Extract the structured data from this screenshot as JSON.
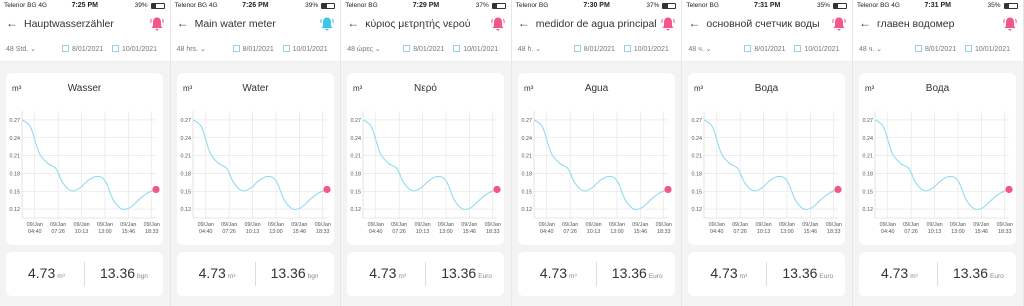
{
  "accent": "#f2568a",
  "line_color": "#8fdcf2",
  "screens": [
    {
      "carrier": "Telenor BG  4G",
      "time": "7:25 PM",
      "battery_pct": "39%",
      "battery": 0.39,
      "title": "Hauptwasserzähler",
      "period": "48 Std.",
      "date_from": "8/01/2021",
      "date_to": "10/01/2021",
      "chart_unit": "m³",
      "chart_title": "Wasser",
      "volume": "4.73",
      "volume_unit": "m³",
      "cost": "13.36",
      "currency": "bgn",
      "bell_color": "#f2568a"
    },
    {
      "carrier": "Telenor BG  4G",
      "time": "7:26 PM",
      "battery_pct": "39%",
      "battery": 0.39,
      "title": "Main water meter",
      "period": "48 hrs.",
      "date_from": "8/01/2021",
      "date_to": "10/01/2021",
      "chart_unit": "m³",
      "chart_title": "Water",
      "volume": "4.73",
      "volume_unit": "m³",
      "cost": "13.36",
      "currency": "bgn",
      "bell_color": "#3ec6e8"
    },
    {
      "carrier": "Telenor BG",
      "time": "7:29 PM",
      "battery_pct": "37%",
      "battery": 0.37,
      "title": "κύριος μετρητής νερού",
      "period": "48 ώρες",
      "date_from": "8/01/2021",
      "date_to": "10/01/2021",
      "chart_unit": "m³",
      "chart_title": "Νερό",
      "volume": "4.73",
      "volume_unit": "m³",
      "cost": "13.36",
      "currency": "Euro",
      "bell_color": "#f2568a"
    },
    {
      "carrier": "Telenor BG",
      "time": "7:30 PM",
      "battery_pct": "37%",
      "battery": 0.37,
      "title": "medidor de agua principal",
      "period": "48 h.",
      "date_from": "8/01/2021",
      "date_to": "10/01/2021",
      "chart_unit": "m³",
      "chart_title": "Agua",
      "volume": "4.73",
      "volume_unit": "m³",
      "cost": "13.36",
      "currency": "Euro",
      "bell_color": "#f2568a"
    },
    {
      "carrier": "Telenor BG",
      "time": "7:31 PM",
      "battery_pct": "35%",
      "battery": 0.35,
      "title": "основной счетчик воды",
      "period": "48 ч.",
      "date_from": "8/01/2021",
      "date_to": "10/01/2021",
      "chart_unit": "m³",
      "chart_title": "Вода",
      "volume": "4.73",
      "volume_unit": "m³",
      "cost": "13.36",
      "currency": "Euro",
      "bell_color": "#f2568a"
    },
    {
      "carrier": "Telenor BG  4G",
      "time": "7:31 PM",
      "battery_pct": "35%",
      "battery": 0.35,
      "title": "главен водомер",
      "period": "48 ч.",
      "date_from": "8/01/2021",
      "date_to": "10/01/2021",
      "chart_unit": "m³",
      "chart_title": "Вода",
      "volume": "4.73",
      "volume_unit": "m³",
      "cost": "13.36",
      "currency": "Euro",
      "bell_color": "#f2568a"
    }
  ],
  "chart_data": {
    "type": "line",
    "y_ticks": [
      "0.27",
      "0.24",
      "0.21",
      "0.18",
      "0.15",
      "0.12"
    ],
    "y_tick_values": [
      0.27,
      0.24,
      0.21,
      0.18,
      0.15,
      0.12
    ],
    "ylim": [
      0.105,
      0.285
    ],
    "x_ticks": [
      {
        "day": "09/Jan",
        "time": "04:40"
      },
      {
        "day": "09/Jan",
        "time": "07:26"
      },
      {
        "day": "09/Jan",
        "time": "10:13"
      },
      {
        "day": "09/Jan",
        "time": "13:00"
      },
      {
        "day": "09/Jan",
        "time": "15:46"
      },
      {
        "day": "09/Jan",
        "time": "18:33"
      }
    ],
    "grid": true,
    "series": [
      {
        "x": [
          0,
          0.4,
          0.8,
          1.2,
          1.6,
          1.9,
          2.3,
          2.7,
          3.1,
          3.5,
          3.9,
          4.3,
          4.7,
          5.1,
          5.5,
          5.9,
          6.3
        ],
        "values": [
          0.27,
          0.258,
          0.215,
          0.197,
          0.188,
          0.165,
          0.151,
          0.155,
          0.168,
          0.175,
          0.168,
          0.135,
          0.12,
          0.123,
          0.136,
          0.147,
          0.153
        ]
      }
    ],
    "highlight": {
      "x": 6.3,
      "value": 0.153
    }
  }
}
